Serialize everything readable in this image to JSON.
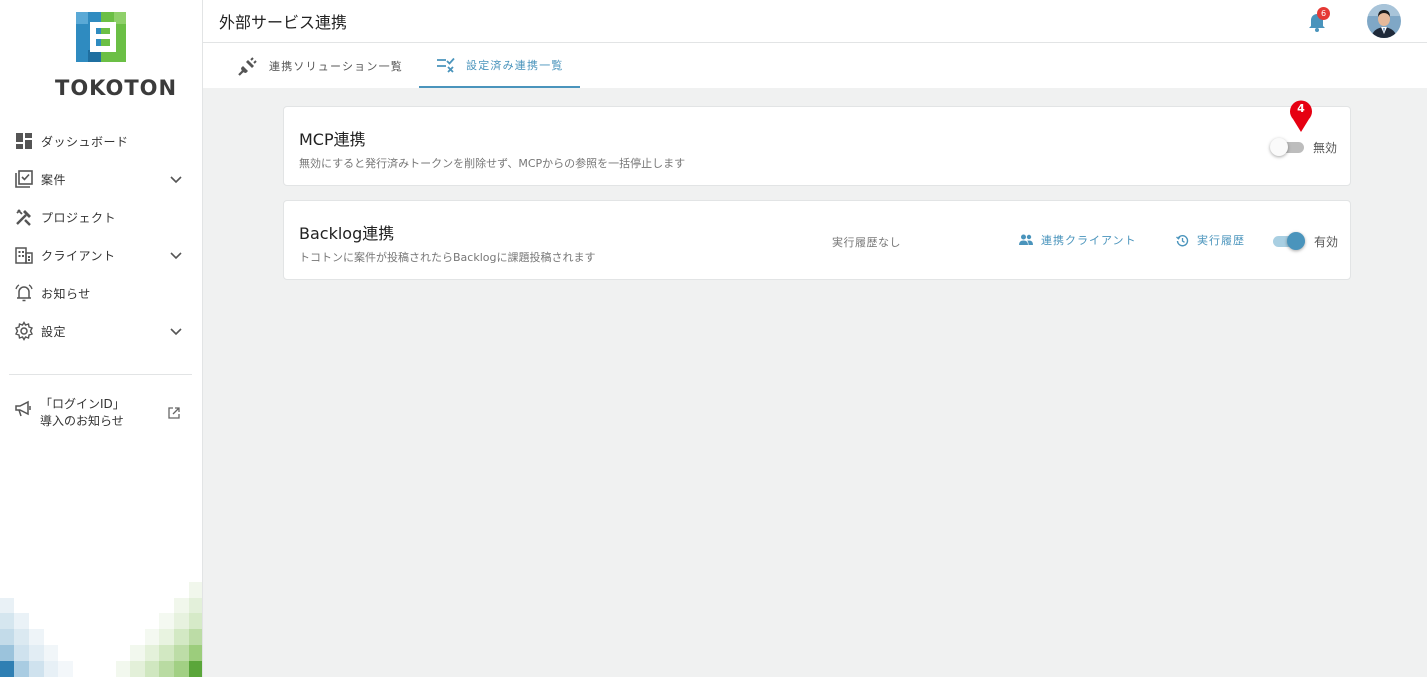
{
  "brand": {
    "name": "TOKOTON"
  },
  "header": {
    "title": "外部サービス連携",
    "notification_count": "6"
  },
  "sidebar": {
    "items": [
      {
        "label": "ダッシュボード"
      },
      {
        "label": "案件"
      },
      {
        "label": "プロジェクト"
      },
      {
        "label": "クライアント"
      },
      {
        "label": "お知らせ"
      },
      {
        "label": "設定"
      }
    ],
    "notice": {
      "line1": "「ログインID」",
      "line2": "導入のお知らせ"
    }
  },
  "tabs": [
    {
      "label": "連携ソリューション一覧"
    },
    {
      "label": "設定済み連携一覧"
    }
  ],
  "integrations": [
    {
      "title": "MCP連携",
      "description": "無効にすると発行済みトークンを削除せず、MCPからの参照を一括停止します",
      "state_label": "無効",
      "enabled": false,
      "marker": "4"
    },
    {
      "title": "Backlog連携",
      "description": "トコトンに案件が投稿されたらBacklogに課題投稿されます",
      "history_status": "実行履歴なし",
      "client_link": "連携クライアント",
      "history_link": "実行履歴",
      "state_label": "有効",
      "enabled": true
    }
  ],
  "colors": {
    "accent": "#4a94bc",
    "logo_blue": "#2f8bc0",
    "logo_green": "#6bbf45",
    "badge": "#e53935"
  }
}
